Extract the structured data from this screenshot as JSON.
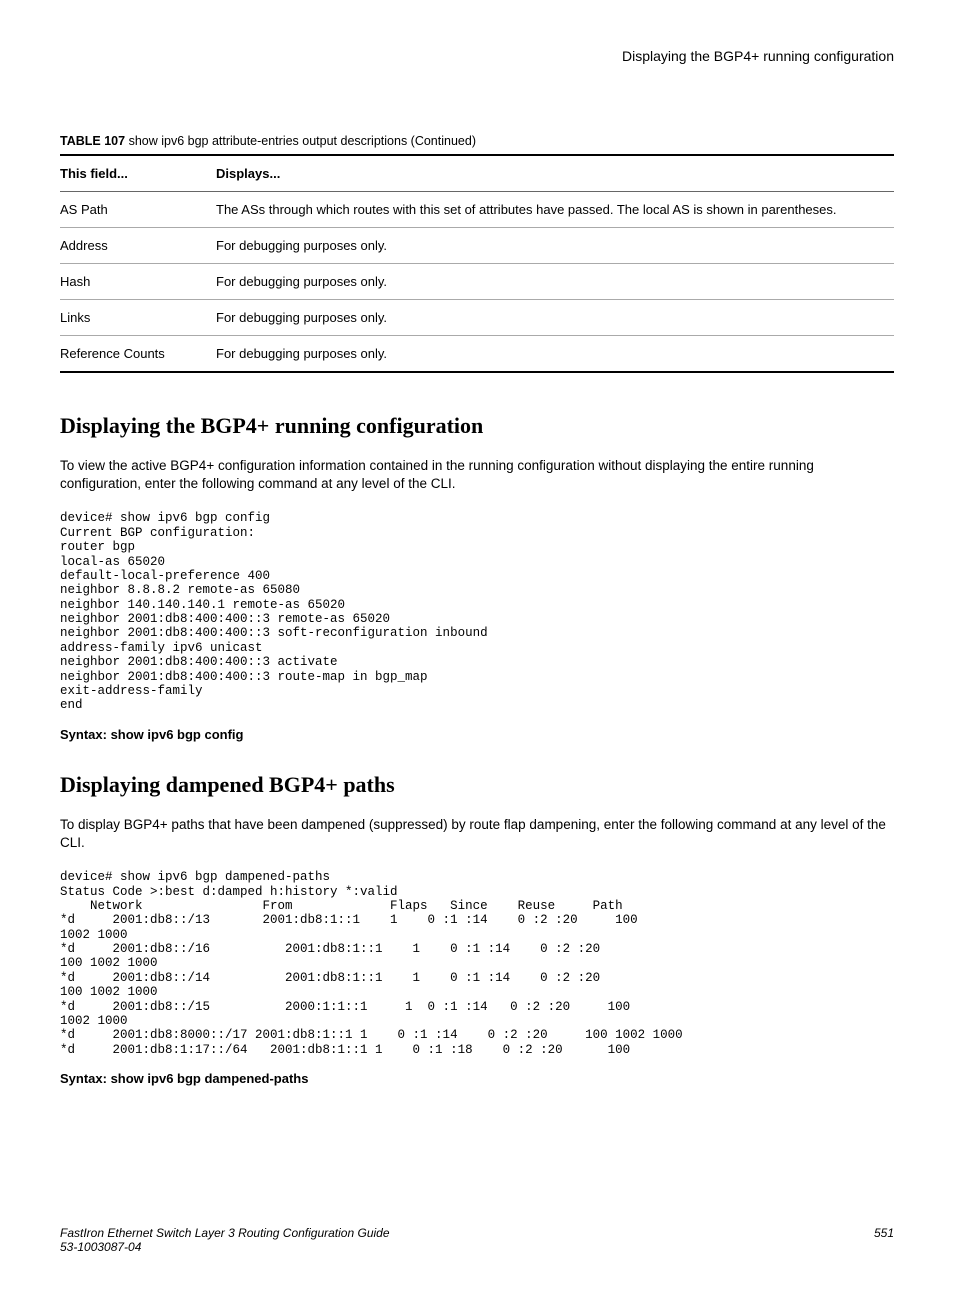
{
  "header": {
    "right": "Displaying the BGP4+ running configuration"
  },
  "table107": {
    "caption_label": "TABLE 107",
    "caption_text": "show ipv6 bgp attribute-entries output descriptions (Continued)",
    "head1": "This field...",
    "head2": "Displays...",
    "rows": [
      {
        "f": "AS Path",
        "d": "The ASs through which routes with this set of attributes have passed. The local AS is shown in parentheses."
      },
      {
        "f": "Address",
        "d": "For debugging purposes only."
      },
      {
        "f": "Hash",
        "d": "For debugging purposes only."
      },
      {
        "f": "Links",
        "d": "For debugging purposes only."
      },
      {
        "f": "Reference Counts",
        "d": "For debugging purposes only."
      }
    ]
  },
  "sec1": {
    "title": "Displaying the BGP4+ running configuration",
    "para": "To view the active BGP4+ configuration information contained in the running configuration without displaying the entire running configuration, enter the following command at any level of the CLI.",
    "code": "device# show ipv6 bgp config\nCurrent BGP configuration:\nrouter bgp\nlocal-as 65020\ndefault-local-preference 400\nneighbor 8.8.8.2 remote-as 65080\nneighbor 140.140.140.1 remote-as 65020\nneighbor 2001:db8:400:400::3 remote-as 65020\nneighbor 2001:db8:400:400::3 soft-reconfiguration inbound\naddress-family ipv6 unicast\nneighbor 2001:db8:400:400::3 activate\nneighbor 2001:db8:400:400::3 route-map in bgp_map\nexit-address-family\nend",
    "syntax": "Syntax: show ipv6 bgp config"
  },
  "sec2": {
    "title": "Displaying dampened BGP4+ paths",
    "para": "To display BGP4+ paths that have been dampened (suppressed) by route flap dampening, enter the following command at any level of the CLI.",
    "code": "device# show ipv6 bgp dampened-paths\nStatus Code >:best d:damped h:history *:valid\n    Network                From             Flaps   Since    Reuse     Path\n*d     2001:db8::/13       2001:db8:1::1    1    0 :1 :14    0 :2 :20     100  \n1002 1000\n*d     2001:db8::/16          2001:db8:1::1    1    0 :1 :14    0 :2 :20     \n100 1002 1000\n*d     2001:db8::/14          2001:db8:1::1    1    0 :1 :14    0 :2 :20     \n100 1002 1000\n*d     2001:db8::/15          2000:1:1::1     1  0 :1 :14   0 :2 :20     100  \n1002 1000\n*d     2001:db8:8000::/17 2001:db8:1::1 1    0 :1 :14    0 :2 :20     100 1002 1000\n*d     2001:db8:1:17::/64   2001:db8:1::1 1    0 :1 :18    0 :2 :20      100",
    "syntax": "Syntax: show ipv6 bgp dampened-paths"
  },
  "footer": {
    "line1": "FastIron Ethernet Switch Layer 3 Routing Configuration Guide",
    "line2": "53-1003087-04",
    "page": "551"
  }
}
